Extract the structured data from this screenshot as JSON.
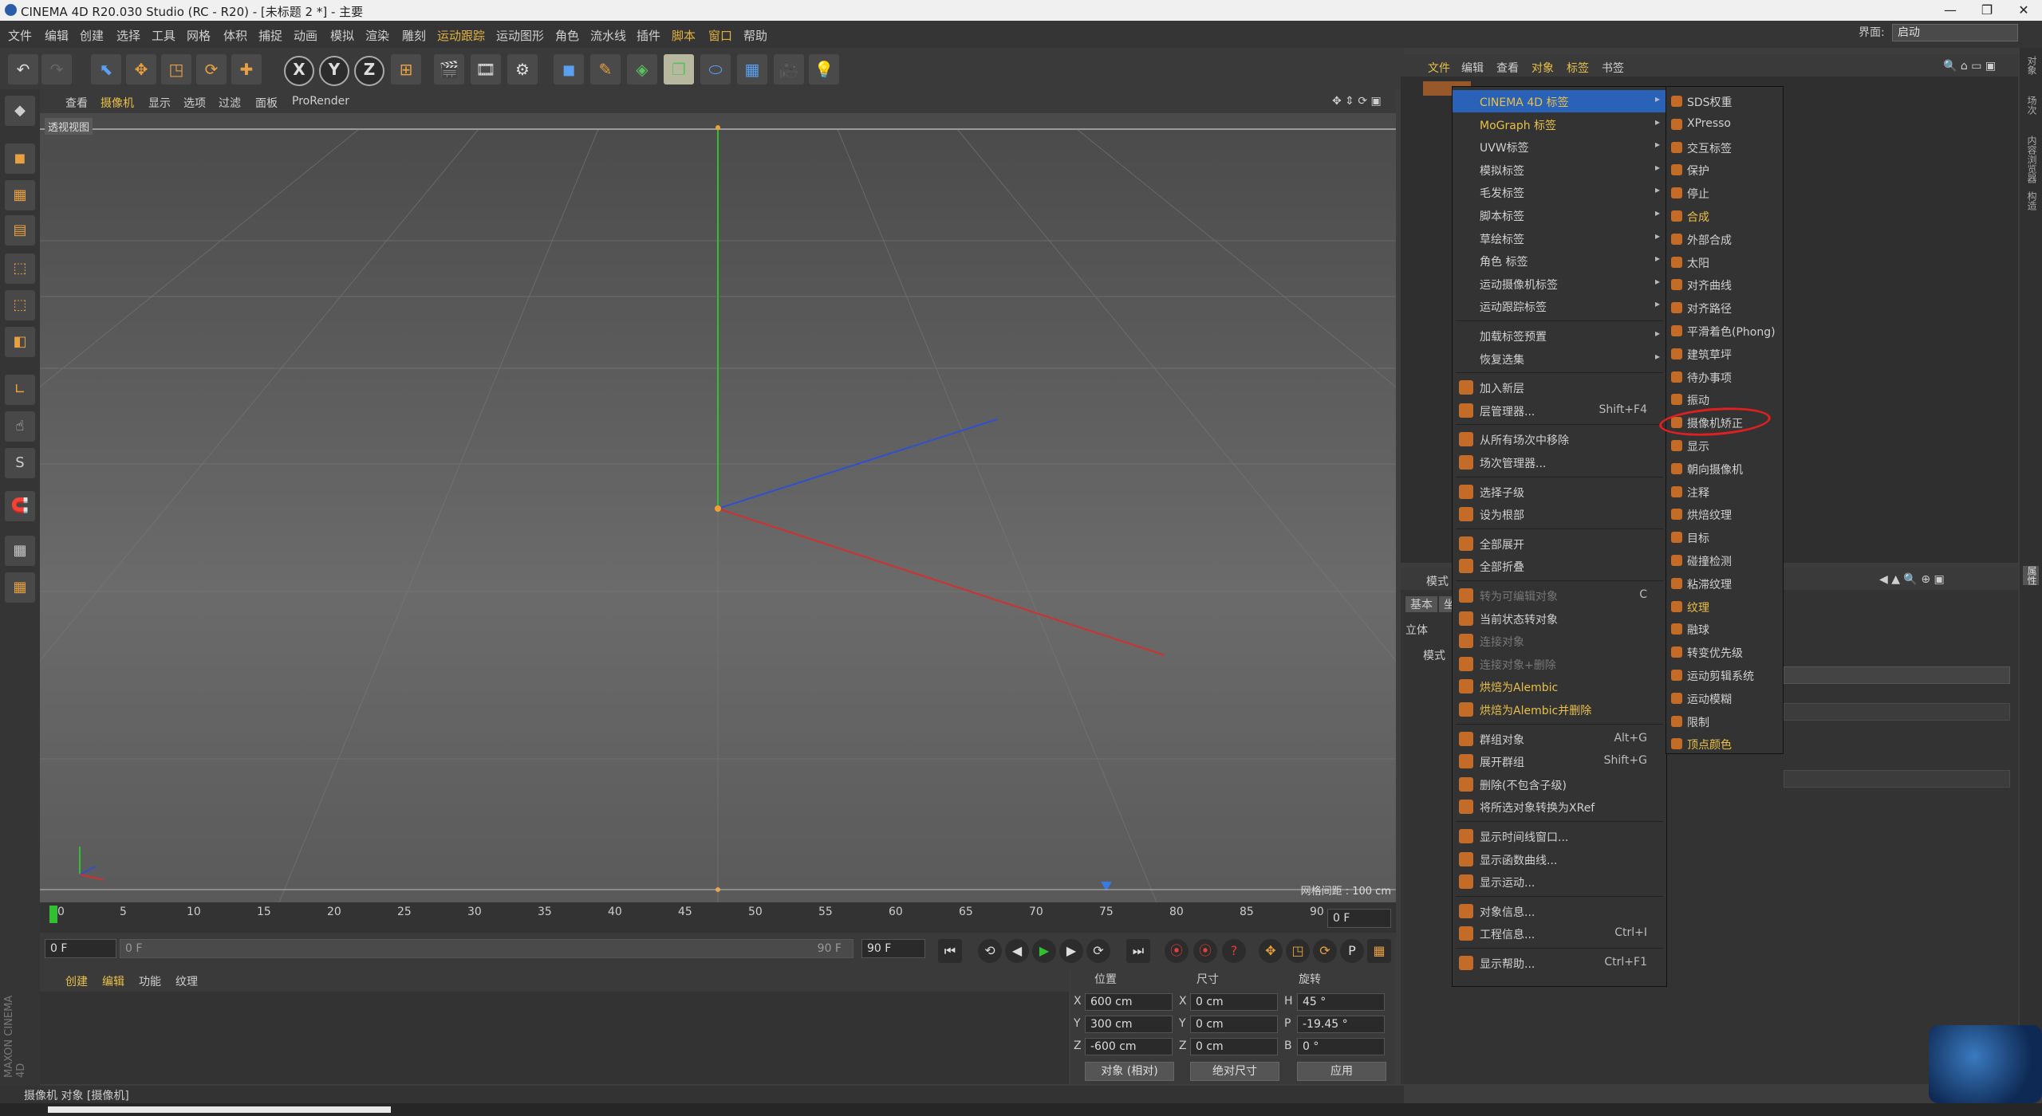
{
  "window": {
    "title": "CINEMA 4D R20.030 Studio (RC - R20) - [未标题 2 *] - 主要",
    "min": "—",
    "restore": "❐",
    "close": "✕"
  },
  "menubar": [
    "文件",
    "编辑",
    "创建",
    "选择",
    "工具",
    "网格",
    "体积",
    "捕捉",
    "动画",
    "模拟",
    "渲染",
    "雕刻",
    "运动跟踪",
    "运动图形",
    "角色",
    "流水线",
    "插件",
    "脚本",
    "窗口",
    "帮助"
  ],
  "layout": {
    "label": "界面:",
    "value": "启动"
  },
  "viewport": {
    "menu": [
      "查看",
      "摄像机",
      "显示",
      "选项",
      "过滤",
      "面板",
      "ProRender"
    ],
    "label": "透视视图",
    "grid_info": "网格间距 : 100 cm"
  },
  "timeline": {
    "ticks": [
      "0",
      "5",
      "10",
      "15",
      "20",
      "25",
      "30",
      "35",
      "40",
      "45",
      "50",
      "55",
      "60",
      "65",
      "70",
      "75",
      "80",
      "85",
      "90"
    ],
    "end_field": "0 F"
  },
  "transport": {
    "start": "0 F",
    "range_start": "0 F",
    "range_end": "90 F",
    "end": "90 F"
  },
  "material": {
    "menu": [
      "创建",
      "编辑",
      "功能",
      "纹理"
    ]
  },
  "coords": {
    "headers": [
      "位置",
      "尺寸",
      "旋转"
    ],
    "rows": [
      {
        "a": "X",
        "pos": "600 cm",
        "b": "X",
        "size": "0 cm",
        "c": "H",
        "rot": "45 °"
      },
      {
        "a": "Y",
        "pos": "300 cm",
        "b": "Y",
        "size": "0 cm",
        "c": "P",
        "rot": "-19.45 °"
      },
      {
        "a": "Z",
        "pos": "-600 cm",
        "b": "Z",
        "size": "0 cm",
        "c": "B",
        "rot": "0 °"
      }
    ],
    "mode1": "对象 (相对)",
    "mode2": "绝对尺寸",
    "apply": "应用"
  },
  "status": "摄像机 对象 [摄像机]",
  "objpanel": {
    "menu": [
      "文件",
      "编辑",
      "查看",
      "对象",
      "标签",
      "书签"
    ]
  },
  "attrpanel": {
    "mode": "模式",
    "tabs": [
      "基本",
      "坐"
    ],
    "items": [
      "立体",
      "模式"
    ]
  },
  "menu1": {
    "items": [
      {
        "label": "CINEMA 4D 标签",
        "arrow": true,
        "selected": true,
        "yellow": true
      },
      {
        "label": "MoGraph 标签",
        "arrow": true,
        "yellow": true
      },
      {
        "label": "UVW标签",
        "arrow": true
      },
      {
        "label": "模拟标签",
        "arrow": true
      },
      {
        "label": "毛发标签",
        "arrow": true
      },
      {
        "label": "脚本标签",
        "arrow": true
      },
      {
        "label": "草绘标签",
        "arrow": true
      },
      {
        "label": "角色 标签",
        "arrow": true
      },
      {
        "label": "运动摄像机标签",
        "arrow": true
      },
      {
        "label": "运动跟踪标签",
        "arrow": true
      },
      {
        "sep": true
      },
      {
        "label": "加载标签预置",
        "arrow": true
      },
      {
        "label": "恢复选集",
        "arrow": true
      },
      {
        "sep": true
      },
      {
        "label": "加入新层",
        "icon": true
      },
      {
        "label": "层管理器...",
        "icon": true,
        "shortcut": "Shift+F4"
      },
      {
        "sep": true
      },
      {
        "label": "从所有场次中移除",
        "icon": true
      },
      {
        "label": "场次管理器...",
        "icon": true
      },
      {
        "sep": true
      },
      {
        "label": "选择子级",
        "icon": true
      },
      {
        "label": "设为根部",
        "icon": true
      },
      {
        "sep": true
      },
      {
        "label": "全部展开",
        "icon": true
      },
      {
        "label": "全部折叠",
        "icon": true
      },
      {
        "sep": true
      },
      {
        "label": "转为可编辑对象",
        "icon": true,
        "dim": true,
        "shortcut": "C"
      },
      {
        "label": "当前状态转对象",
        "icon": true
      },
      {
        "label": "连接对象",
        "icon": true,
        "dim": true
      },
      {
        "label": "连接对象+删除",
        "icon": true,
        "dim": true
      },
      {
        "label": "烘焙为Alembic",
        "icon": true,
        "yellow": true
      },
      {
        "label": "烘焙为Alembic并删除",
        "icon": true,
        "yellow": true
      },
      {
        "sep": true
      },
      {
        "label": "群组对象",
        "icon": true,
        "shortcut": "Alt+G"
      },
      {
        "label": "展开群组",
        "icon": true,
        "shortcut": "Shift+G"
      },
      {
        "label": "删除(不包含子级)",
        "icon": true
      },
      {
        "label": "将所选对象转换为XRef",
        "icon": true
      },
      {
        "sep": true
      },
      {
        "label": "显示时间线窗口...",
        "icon": true
      },
      {
        "label": "显示函数曲线...",
        "icon": true
      },
      {
        "label": "显示运动...",
        "icon": true
      },
      {
        "sep": true
      },
      {
        "label": "对象信息...",
        "icon": true
      },
      {
        "label": "工程信息...",
        "icon": true,
        "shortcut": "Ctrl+I"
      },
      {
        "sep": true
      },
      {
        "label": "显示帮助...",
        "icon": true,
        "shortcut": "Ctrl+F1"
      }
    ]
  },
  "menu2": {
    "items": [
      {
        "label": "SDS权重"
      },
      {
        "label": "XPresso"
      },
      {
        "label": "交互标签"
      },
      {
        "label": "保护"
      },
      {
        "label": "停止"
      },
      {
        "label": "合成",
        "yellow": true
      },
      {
        "label": "外部合成"
      },
      {
        "label": "太阳"
      },
      {
        "label": "对齐曲线"
      },
      {
        "label": "对齐路径"
      },
      {
        "label": "平滑着色(Phong)"
      },
      {
        "label": "建筑草坪"
      },
      {
        "label": "待办事项"
      },
      {
        "label": "振动"
      },
      {
        "label": "摄像机矫正",
        "highlight": true
      },
      {
        "label": "显示"
      },
      {
        "label": "朝向摄像机"
      },
      {
        "label": "注释"
      },
      {
        "label": "烘焙纹理"
      },
      {
        "label": "目标"
      },
      {
        "label": "碰撞检测"
      },
      {
        "label": "粘滞纹理"
      },
      {
        "label": "纹理",
        "yellow": true
      },
      {
        "label": "融球"
      },
      {
        "label": "转变优先级"
      },
      {
        "label": "运动剪辑系统"
      },
      {
        "label": "运动模糊"
      },
      {
        "label": "限制"
      },
      {
        "label": "顶点颜色",
        "yellow": true
      }
    ]
  },
  "colors": {
    "accent": "#2a62b8",
    "highlight_text": "#e8c048",
    "annotation": "#e02020"
  }
}
